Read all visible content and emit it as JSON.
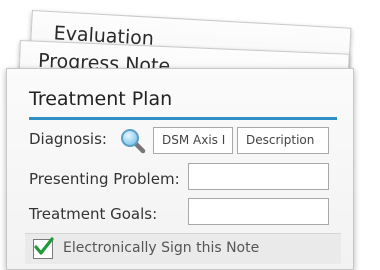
{
  "sheets": {
    "evaluation_title": "Evaluation",
    "progress_note_title": "Progress Note"
  },
  "form": {
    "title": "Treatment Plan",
    "diagnosis_label": "Diagnosis:",
    "dsm_axis_placeholder": "DSM Axis I",
    "description_placeholder": "Description",
    "presenting_problem_label": "Presenting Problem:",
    "treatment_goals_label": "Treatment Goals:",
    "sign_label": "Electronically Sign this Note",
    "sign_checked": true
  },
  "colors": {
    "accent": "#2f8fc7",
    "check": "#1f9a3a"
  },
  "icons": {
    "search": "magnifier-icon",
    "check": "checkmark-icon"
  }
}
